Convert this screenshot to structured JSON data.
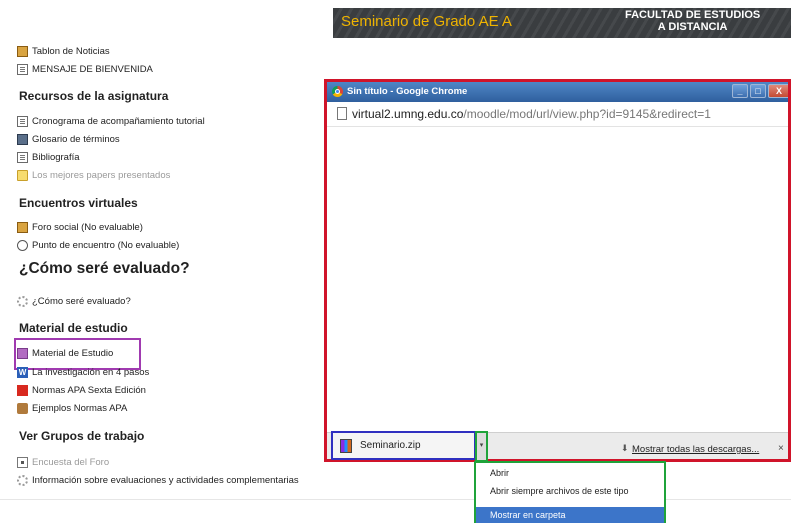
{
  "banner": {
    "title": "Seminario de Grado AE A",
    "right_line1": "FACULTAD DE ESTUDIOS",
    "right_line2": "A DISTANCIA"
  },
  "menu": {
    "top_items": [
      {
        "label": "Tablon de Noticias",
        "icon": "forum-icon"
      },
      {
        "label": "MENSAJE DE BIENVENIDA",
        "icon": "page-icon"
      }
    ],
    "sections": [
      {
        "title": "Recursos de la asignatura",
        "items": [
          {
            "label": "Cronograma de acompañamiento tutorial",
            "icon": "page-icon"
          },
          {
            "label": "Glosario de términos",
            "icon": "glossary-icon"
          },
          {
            "label": "Bibliografía",
            "icon": "page-icon"
          },
          {
            "label": "Los mejores papers presentados",
            "icon": "folder-icon"
          }
        ]
      },
      {
        "title": "Encuentros virtuales",
        "items": [
          {
            "label": "Foro social (No evaluable)",
            "icon": "forum-icon"
          },
          {
            "label": "Punto de encuentro (No evaluable)",
            "icon": "chat-icon"
          }
        ]
      },
      {
        "title": "¿Cómo seré evaluado?",
        "items": [
          {
            "label": "¿Cómo seré evaluado?",
            "icon": "gear-icon"
          }
        ]
      },
      {
        "title": "Material de estudio",
        "items": [
          {
            "label": "Material de Estudio",
            "icon": "book-icon"
          },
          {
            "label": "La investigación en 4 pasos",
            "icon": "word-icon"
          },
          {
            "label": "Normas APA Sexta Edición",
            "icon": "pdf-icon"
          },
          {
            "label": "Ejemplos Normas APA",
            "icon": "package-icon"
          }
        ]
      },
      {
        "title": "Ver Grupos de trabajo",
        "items": [
          {
            "label": "Encuesta del Foro",
            "icon": "survey-icon"
          },
          {
            "label": "Información sobre evaluaciones y actividades complementarias",
            "icon": "gear-icon"
          }
        ]
      }
    ]
  },
  "chrome": {
    "title": "Sin título - Google Chrome",
    "min_btn": "_",
    "max_btn": "□",
    "close_btn": "X",
    "url_host": "virtual2.umng.edu.co",
    "url_path": "/moodle/mod/url/view.php?id=9145&redirect=1"
  },
  "download": {
    "filename": "Seminario.zip",
    "arrow": "▾",
    "show_all": "Mostrar todas las descargas...",
    "close": "×"
  },
  "context_menu": {
    "items": [
      "Abrir",
      "Abrir siempre archivos de este tipo",
      "Mostrar en carpeta"
    ],
    "selected_index": 2
  }
}
